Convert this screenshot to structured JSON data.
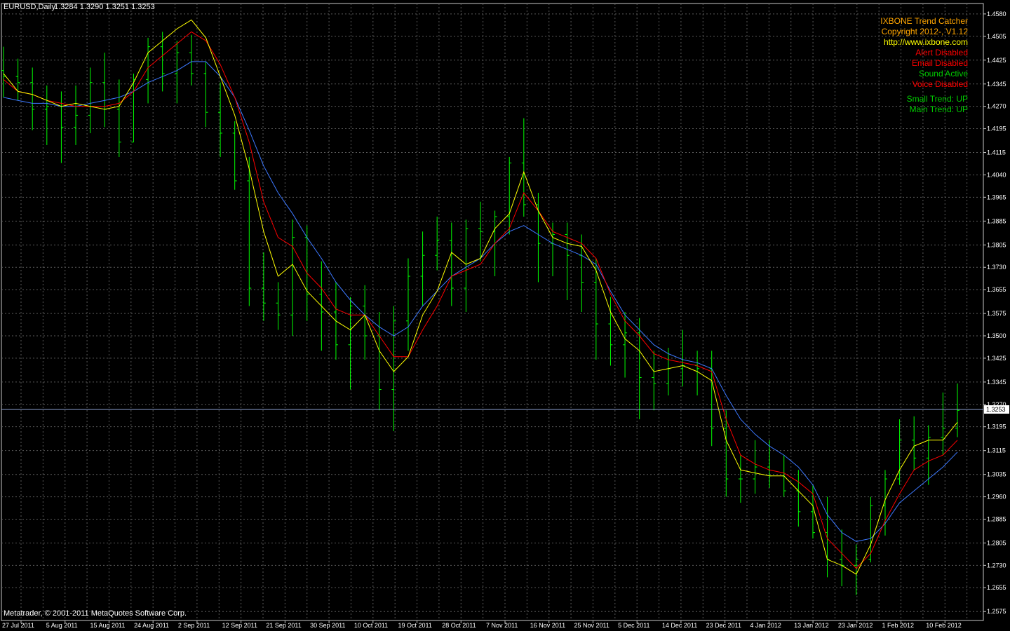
{
  "header": {
    "symbol": "EURUSD,Daily",
    "ohlc": "1.3284 1.3290 1.3251 1.3253"
  },
  "copyright": "Metatrader, © 2001-2011 MetaQuotes Software Corp.",
  "indicator": {
    "lines": [
      {
        "text": "IXBONE Trend Catcher",
        "color": "#FFA500"
      },
      {
        "text": "Copyright 2012-, V1.12",
        "color": "#FFA500"
      },
      {
        "text": "http://www.ixbone.com",
        "color": "#FFFF00"
      },
      {
        "text": "Alert Disabled",
        "color": "#FF0000"
      },
      {
        "text": "Email Disabled",
        "color": "#FF0000"
      },
      {
        "text": "Sound Active",
        "color": "#00CC00"
      },
      {
        "text": "Voice Disabled",
        "color": "#FF0000"
      },
      {
        "text": "Small Trend: UP",
        "color": "#00CC00"
      },
      {
        "text": "Main Trend: UP",
        "color": "#00CC00"
      }
    ]
  },
  "current_price": "1.3253",
  "chart_data": {
    "type": "ohlc",
    "colors": {
      "bars": "#00FF00",
      "grid": "#5A5A5A",
      "fast_ma": "#FFFF00",
      "mid_ma": "#FF0000",
      "slow_ma": "#3C78FF",
      "price_line": "#8CA0D2"
    },
    "ylim": [
      1.2545,
      1.4615
    ],
    "y_ticks": [
      "1.4580",
      "1.4505",
      "1.4425",
      "1.4345",
      "1.4270",
      "1.4195",
      "1.4115",
      "1.4040",
      "1.3965",
      "1.3885",
      "1.3805",
      "1.3730",
      "1.3655",
      "1.3575",
      "1.3500",
      "1.3425",
      "1.3345",
      "1.3270",
      "1.3195",
      "1.3115",
      "1.3035",
      "1.2960",
      "1.2885",
      "1.2805",
      "1.2730",
      "1.2655",
      "1.2575"
    ],
    "x_ticks": [
      "27 Jul 2011",
      "5 Aug 2011",
      "15 Aug 2011",
      "24 Aug 2011",
      "2 Sep 2011",
      "12 Sep 2011",
      "21 Sep 2011",
      "30 Sep 2011",
      "10 Oct 2011",
      "19 Oct 2011",
      "28 Oct 2011",
      "7 Nov 2011",
      "16 Nov 2011",
      "25 Nov 2011",
      "5 Dec 2011",
      "14 Dec 2011",
      "23 Dec 2011",
      "4 Jan 2012",
      "13 Jan 2012",
      "23 Jan 2012",
      "1 Feb 2012",
      "10 Feb 2012"
    ],
    "fast_ma": [
      1.438,
      1.432,
      1.431,
      1.429,
      1.427,
      1.428,
      1.427,
      1.426,
      1.427,
      1.435,
      1.445,
      1.449,
      1.453,
      1.456,
      1.45,
      1.437,
      1.424,
      1.406,
      1.385,
      1.37,
      1.374,
      1.365,
      1.36,
      1.355,
      1.352,
      1.357,
      1.345,
      1.338,
      1.343,
      1.357,
      1.365,
      1.378,
      1.374,
      1.376,
      1.386,
      1.391,
      1.405,
      1.392,
      1.383,
      1.381,
      1.38,
      1.372,
      1.358,
      1.349,
      1.345,
      1.338,
      1.339,
      1.34,
      1.338,
      1.335,
      1.315,
      1.305,
      1.304,
      1.303,
      1.303,
      1.298,
      1.293,
      1.275,
      1.273,
      1.27,
      1.28,
      1.295,
      1.305,
      1.313,
      1.315,
      1.315,
      1.321
    ],
    "mid_ma": [
      1.436,
      1.432,
      1.431,
      1.429,
      1.428,
      1.427,
      1.427,
      1.427,
      1.428,
      1.432,
      1.44,
      1.444,
      1.448,
      1.452,
      1.449,
      1.441,
      1.43,
      1.415,
      1.395,
      1.383,
      1.38,
      1.371,
      1.366,
      1.359,
      1.357,
      1.357,
      1.35,
      1.343,
      1.343,
      1.352,
      1.36,
      1.37,
      1.372,
      1.374,
      1.381,
      1.386,
      1.398,
      1.392,
      1.385,
      1.383,
      1.381,
      1.376,
      1.364,
      1.355,
      1.35,
      1.344,
      1.342,
      1.341,
      1.34,
      1.338,
      1.322,
      1.31,
      1.307,
      1.305,
      1.304,
      1.301,
      1.297,
      1.282,
      1.277,
      1.272,
      1.277,
      1.288,
      1.297,
      1.305,
      1.308,
      1.31,
      1.315
    ],
    "slow_ma": [
      1.43,
      1.429,
      1.428,
      1.428,
      1.427,
      1.427,
      1.428,
      1.429,
      1.43,
      1.432,
      1.435,
      1.437,
      1.439,
      1.442,
      1.442,
      1.437,
      1.43,
      1.419,
      1.407,
      1.398,
      1.391,
      1.383,
      1.376,
      1.368,
      1.362,
      1.357,
      1.353,
      1.35,
      1.353,
      1.36,
      1.365,
      1.37,
      1.373,
      1.376,
      1.381,
      1.385,
      1.387,
      1.384,
      1.381,
      1.379,
      1.377,
      1.374,
      1.365,
      1.357,
      1.352,
      1.347,
      1.344,
      1.342,
      1.341,
      1.339,
      1.33,
      1.322,
      1.317,
      1.313,
      1.31,
      1.306,
      1.3,
      1.29,
      1.284,
      1.281,
      1.282,
      1.287,
      1.294,
      1.298,
      1.302,
      1.306,
      1.311
    ],
    "bars": [
      [
        1.439,
        1.447,
        1.43,
        1.437
      ],
      [
        1.437,
        1.443,
        1.429,
        1.435
      ],
      [
        1.435,
        1.44,
        1.419,
        1.426
      ],
      [
        1.426,
        1.434,
        1.414,
        1.427
      ],
      [
        1.427,
        1.432,
        1.408,
        1.42
      ],
      [
        1.42,
        1.434,
        1.414,
        1.424
      ],
      [
        1.424,
        1.44,
        1.418,
        1.435
      ],
      [
        1.435,
        1.445,
        1.42,
        1.426
      ],
      [
        1.426,
        1.436,
        1.41,
        1.415
      ],
      [
        1.415,
        1.438,
        1.415,
        1.436
      ],
      [
        1.436,
        1.45,
        1.428,
        1.447
      ],
      [
        1.447,
        1.452,
        1.432,
        1.438
      ],
      [
        1.438,
        1.449,
        1.428,
        1.445
      ],
      [
        1.445,
        1.451,
        1.434,
        1.438
      ],
      [
        1.438,
        1.442,
        1.42,
        1.425
      ],
      [
        1.425,
        1.435,
        1.41,
        1.418
      ],
      [
        1.418,
        1.422,
        1.399,
        1.402
      ],
      [
        1.402,
        1.41,
        1.36,
        1.366
      ],
      [
        1.366,
        1.378,
        1.355,
        1.361
      ],
      [
        1.361,
        1.368,
        1.352,
        1.357
      ],
      [
        1.357,
        1.389,
        1.35,
        1.383
      ],
      [
        1.383,
        1.387,
        1.355,
        1.364
      ],
      [
        1.364,
        1.375,
        1.345,
        1.358
      ],
      [
        1.358,
        1.368,
        1.342,
        1.347
      ],
      [
        1.347,
        1.363,
        1.332,
        1.36
      ],
      [
        1.36,
        1.367,
        1.342,
        1.35
      ],
      [
        1.35,
        1.358,
        1.325,
        1.332
      ],
      [
        1.332,
        1.36,
        1.318,
        1.355
      ],
      [
        1.355,
        1.376,
        1.345,
        1.37
      ],
      [
        1.37,
        1.385,
        1.36,
        1.377
      ],
      [
        1.377,
        1.39,
        1.372,
        1.382
      ],
      [
        1.382,
        1.388,
        1.36,
        1.366
      ],
      [
        1.366,
        1.389,
        1.358,
        1.386
      ],
      [
        1.386,
        1.395,
        1.375,
        1.385
      ],
      [
        1.385,
        1.392,
        1.37,
        1.39
      ],
      [
        1.39,
        1.41,
        1.384,
        1.408
      ],
      [
        1.408,
        1.423,
        1.39,
        1.394
      ],
      [
        1.394,
        1.398,
        1.368,
        1.381
      ],
      [
        1.381,
        1.388,
        1.37,
        1.384
      ],
      [
        1.384,
        1.388,
        1.362,
        1.377
      ],
      [
        1.377,
        1.384,
        1.358,
        1.368
      ],
      [
        1.368,
        1.376,
        1.342,
        1.354
      ],
      [
        1.354,
        1.363,
        1.34,
        1.347
      ],
      [
        1.347,
        1.358,
        1.336,
        1.351
      ],
      [
        1.351,
        1.356,
        1.322,
        1.336
      ],
      [
        1.336,
        1.345,
        1.325,
        1.334
      ],
      [
        1.334,
        1.346,
        1.33,
        1.339
      ],
      [
        1.339,
        1.352,
        1.333,
        1.34
      ],
      [
        1.34,
        1.345,
        1.33,
        1.339
      ],
      [
        1.339,
        1.345,
        1.313,
        1.319
      ],
      [
        1.319,
        1.325,
        1.296,
        1.302
      ],
      [
        1.302,
        1.31,
        1.294,
        1.302
      ],
      [
        1.302,
        1.315,
        1.297,
        1.306
      ],
      [
        1.306,
        1.315,
        1.299,
        1.303
      ],
      [
        1.303,
        1.31,
        1.296,
        1.298
      ],
      [
        1.298,
        1.305,
        1.286,
        1.291
      ],
      [
        1.291,
        1.3,
        1.282,
        1.284
      ],
      [
        1.284,
        1.296,
        1.269,
        1.275
      ],
      [
        1.275,
        1.285,
        1.266,
        1.273
      ],
      [
        1.273,
        1.28,
        1.263,
        1.275
      ],
      [
        1.275,
        1.296,
        1.274,
        1.293
      ],
      [
        1.293,
        1.305,
        1.283,
        1.302
      ],
      [
        1.302,
        1.322,
        1.3,
        1.315
      ],
      [
        1.315,
        1.323,
        1.305,
        1.309
      ],
      [
        1.309,
        1.32,
        1.3,
        1.316
      ],
      [
        1.316,
        1.331,
        1.31,
        1.319
      ],
      [
        1.319,
        1.334,
        1.316,
        1.325
      ]
    ]
  }
}
